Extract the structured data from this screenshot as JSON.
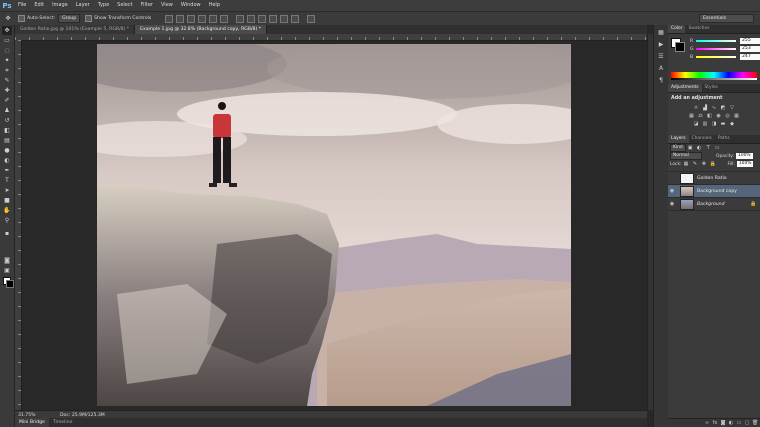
{
  "app": {
    "logo": "Ps"
  },
  "menu": [
    "File",
    "Edit",
    "Image",
    "Layer",
    "Type",
    "Select",
    "Filter",
    "View",
    "Window",
    "Help"
  ],
  "options_bar": {
    "auto_select_label": "Auto-Select:",
    "auto_select_value": "Group",
    "show_transform_label": "Show Transform Controls",
    "workspace": "Essentials"
  },
  "doc_tabs": [
    {
      "label": "Golden Ratio.jpg @ 101% (Example 5, RGB/8) *",
      "active": false
    },
    {
      "label": "Example 1.jpg @ 32.8% (Background copy, RGB/8) *",
      "active": true
    }
  ],
  "status": {
    "zoom": "31.75%",
    "doc_info": "Doc: 25.9M/125.3M"
  },
  "bottom_tabs": [
    {
      "label": "Mini Bridge",
      "active": true
    },
    {
      "label": "Timeline",
      "active": false
    }
  ],
  "color_panel": {
    "tabs": [
      "Color",
      "Swatches"
    ],
    "r": "255",
    "g": "253",
    "b": "247",
    "r_label": "R",
    "g_label": "G",
    "b_label": "B"
  },
  "adjustments_panel": {
    "tabs": [
      "Adjustments",
      "Styles"
    ],
    "title": "Add an adjustment"
  },
  "layers_panel": {
    "tabs": [
      "Layers",
      "Channels",
      "Paths"
    ],
    "kind_label": "Kind",
    "blend_mode": "Normal",
    "opacity_label": "Opacity:",
    "opacity": "100%",
    "lock_label": "Lock:",
    "fill_label": "Fill:",
    "fill": "100%",
    "layers": [
      {
        "name": "Golden Ratio",
        "visible": false,
        "selected": false,
        "locked": false
      },
      {
        "name": "Background copy",
        "visible": true,
        "selected": true,
        "locked": false
      },
      {
        "name": "Background",
        "visible": true,
        "selected": false,
        "locked": true
      }
    ]
  },
  "icons": {
    "move": "move-icon",
    "marquee": "marquee-icon",
    "lasso": "lasso-icon",
    "wand": "magic-wand-icon",
    "crop": "crop-icon",
    "eyedropper": "eyedropper-icon",
    "brush": "brush-icon",
    "eye": "eye-icon",
    "lock": "lock-icon"
  },
  "colors": {
    "accent": "#55657a",
    "panel": "#3b3b3b",
    "logo": "#7ac1ff"
  }
}
